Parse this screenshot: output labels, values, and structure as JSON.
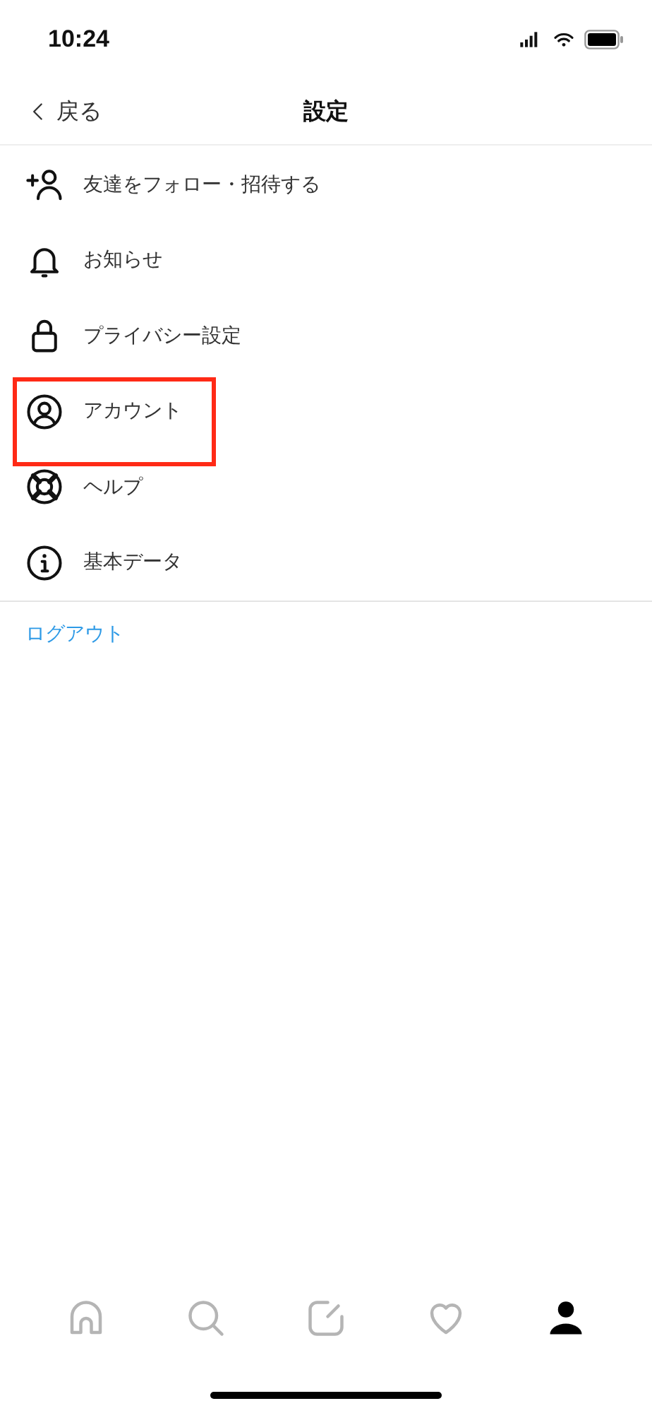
{
  "status_bar": {
    "time": "10:24"
  },
  "nav": {
    "back": "戻る",
    "title": "設定"
  },
  "menu": [
    {
      "kind": "add-person",
      "label": "友達をフォロー・招待する",
      "highlighted": false
    },
    {
      "kind": "bell",
      "label": "お知らせ",
      "highlighted": false
    },
    {
      "kind": "lock",
      "label": "プライバシー設定",
      "highlighted": false
    },
    {
      "kind": "account",
      "label": "アカウント",
      "highlighted": true
    },
    {
      "kind": "help",
      "label": "ヘルプ",
      "highlighted": false
    },
    {
      "kind": "info",
      "label": "基本データ",
      "highlighted": false
    }
  ],
  "logout": "ログアウト",
  "tab_bar": [
    {
      "kind": "home",
      "selected": false
    },
    {
      "kind": "search",
      "selected": false
    },
    {
      "kind": "compose",
      "selected": false
    },
    {
      "kind": "heart",
      "selected": false
    },
    {
      "kind": "profile",
      "selected": true
    }
  ]
}
